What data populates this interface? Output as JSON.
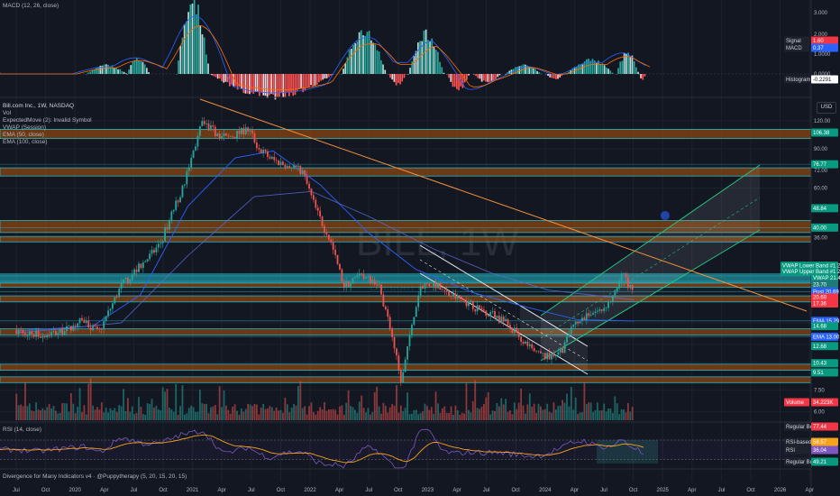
{
  "header": {
    "macd_legend": "MACD (12, 26, close)",
    "symbol_legend": "Bill.com Inc., 1W, NASDAQ",
    "indicator_legend": [
      "Vol",
      "ExpectedMove (2): Invalid Symbol",
      "VWAP (Session)",
      "EMA (50, close)",
      "EMA (100, close)"
    ],
    "rsi_legend": "RSI (14, close)",
    "footer_credit": "Divergence for Many Indicators v4 · @Puppytherapy (5, 20, 15, 20, 15)",
    "currency": "USD",
    "watermark": "BILL, 1W",
    "watermark_sub": "Bill.com Inc."
  },
  "macd_axis": [
    "3.000",
    "2.000",
    "1.0000",
    "0.0000"
  ],
  "macd_tags": [
    {
      "label": "Signal",
      "value": "1.60",
      "color": "#f23645"
    },
    {
      "label": "MACD",
      "value": "0.37",
      "color": "#2962ff"
    },
    {
      "label": "Histogram",
      "value": "-0.2291",
      "color": "#131722"
    }
  ],
  "price_axis": [
    "120.00",
    "90.00",
    "72.00",
    "60.00",
    "36.00",
    "21.00",
    "15.00",
    "12.00",
    "10.00",
    "7.50",
    "6.00"
  ],
  "price_tags": [
    {
      "text": "106.38",
      "bg": "#089981",
      "p": 106.38
    },
    {
      "text": "76.77",
      "bg": "#089981",
      "p": 76.77
    },
    {
      "text": "48.84",
      "bg": "#089981",
      "p": 48.84
    },
    {
      "text": "40.00",
      "bg": "#089981",
      "p": 40.0
    },
    {
      "text": "VWAP Lower Band #1  21.46",
      "bg": "#089981",
      "p": 27.0
    },
    {
      "text": "VWAP Upper Band #1  21.40",
      "bg": "#089981",
      "p": 25.4
    },
    {
      "text": "VWAP  21.40",
      "bg": "#089981",
      "p": 23.8
    },
    {
      "text": "23.70",
      "bg": "#1f7a77",
      "p": 22.3
    },
    {
      "text": "Post  20.69",
      "bg": "#2962ff",
      "p": 20.69
    },
    {
      "text": "20.69",
      "bg": "#f23645",
      "p": 19.5
    },
    {
      "text": "17.36",
      "bg": "#f23645",
      "p": 18.3
    },
    {
      "text": "EMA  15.29",
      "bg": "#2962ff",
      "p": 15.29
    },
    {
      "text": "14.68",
      "bg": "#089981",
      "p": 14.5
    },
    {
      "text": "EMA  13.00",
      "bg": "#2962ff",
      "p": 13.0
    },
    {
      "text": "12.68",
      "bg": "#089981",
      "p": 11.8
    },
    {
      "text": "10.43",
      "bg": "#089981",
      "p": 9.9
    },
    {
      "text": "9.51",
      "bg": "#089981",
      "p": 9.0
    }
  ],
  "vol_tag": {
    "label": "Volume",
    "value": "34.223K"
  },
  "rsi_tags": [
    {
      "label": "Regular Bearish",
      "value": "77.44",
      "color": "#f23645"
    },
    {
      "label": "RSI-based MA",
      "value": "58.57",
      "color": "#f7a21b"
    },
    {
      "label": "RSI",
      "value": "36.04",
      "color": "#7e57c2"
    },
    {
      "label": "Regular Bullish",
      "value": "49.21",
      "color": "#089981"
    }
  ],
  "time_axis": [
    "Jul",
    "Oct",
    "2020",
    "Apr",
    "Jul",
    "Oct",
    "2021",
    "Apr",
    "Jul",
    "Oct",
    "2022",
    "Apr",
    "Jul",
    "Oct",
    "2023",
    "Apr",
    "Jul",
    "Oct",
    "2024",
    "Apr",
    "Jul",
    "Oct",
    "2025",
    "Apr",
    "Jul",
    "Oct",
    "2026",
    "Apr"
  ],
  "colors": {
    "background": "#131722",
    "up": "#26a69a",
    "down": "#ef5350",
    "zone": "#8b4513",
    "teal": "#22b8c7",
    "green": "#4caf50",
    "rsi": "#7e57c2",
    "rsi_ma": "#f7a21b"
  },
  "chart_data": {
    "type": "candlestick",
    "title": "Bill.com Inc., 1W, NASDAQ",
    "scale": "log",
    "ylim": [
      5.5,
      150
    ],
    "prices": [
      {
        "date": "2019-07-01",
        "price": 14.0
      },
      {
        "date": "2019-09-15",
        "price": 13.2
      },
      {
        "date": "2019-12-01",
        "price": 13.8
      },
      {
        "date": "2020-02-01",
        "price": 15.5
      },
      {
        "date": "2020-03-20",
        "price": 13.5
      },
      {
        "date": "2020-06-01",
        "price": 22.0
      },
      {
        "date": "2020-08-01",
        "price": 27.0
      },
      {
        "date": "2020-10-01",
        "price": 33.0
      },
      {
        "date": "2020-11-15",
        "price": 48.0
      },
      {
        "date": "2020-12-15",
        "price": 60.0
      },
      {
        "date": "2021-01-15",
        "price": 85.0
      },
      {
        "date": "2021-02-15",
        "price": 118.0
      },
      {
        "date": "2021-03-15",
        "price": 110.0
      },
      {
        "date": "2021-05-01",
        "price": 100.0
      },
      {
        "date": "2021-07-15",
        "price": 110.0
      },
      {
        "date": "2021-08-15",
        "price": 90.0
      },
      {
        "date": "2021-10-01",
        "price": 80.0
      },
      {
        "date": "2021-11-15",
        "price": 76.0
      },
      {
        "date": "2022-01-01",
        "price": 72.0
      },
      {
        "date": "2022-02-15",
        "price": 48.0
      },
      {
        "date": "2022-04-01",
        "price": 35.0
      },
      {
        "date": "2022-05-15",
        "price": 22.0
      },
      {
        "date": "2022-07-01",
        "price": 24.0
      },
      {
        "date": "2022-09-01",
        "price": 23.0
      },
      {
        "date": "2022-10-15",
        "price": 13.5
      },
      {
        "date": "2022-11-15",
        "price": 8.0
      },
      {
        "date": "2022-12-15",
        "price": 13.5
      },
      {
        "date": "2023-01-15",
        "price": 22.0
      },
      {
        "date": "2023-03-01",
        "price": 22.5
      },
      {
        "date": "2023-04-15",
        "price": 20.0
      },
      {
        "date": "2023-06-01",
        "price": 19.0
      },
      {
        "date": "2023-07-15",
        "price": 17.5
      },
      {
        "date": "2023-09-01",
        "price": 16.5
      },
      {
        "date": "2023-10-15",
        "price": 15.0
      },
      {
        "date": "2023-12-01",
        "price": 13.0
      },
      {
        "date": "2024-01-15",
        "price": 11.0
      },
      {
        "date": "2024-03-01",
        "price": 10.5
      },
      {
        "date": "2024-04-15",
        "price": 11.5
      },
      {
        "date": "2024-05-15",
        "price": 14.0
      },
      {
        "date": "2024-07-01",
        "price": 16.5
      },
      {
        "date": "2024-08-15",
        "price": 17.0
      },
      {
        "date": "2024-10-01",
        "price": 20.0
      },
      {
        "date": "2024-10-25",
        "price": 26.0
      },
      {
        "date": "2024-11-10",
        "price": 22.0
      },
      {
        "date": "2024-12-01",
        "price": 20.69
      }
    ],
    "ema50": [
      {
        "date": "2019-07-01",
        "price": 13.8
      },
      {
        "date": "2020-03-01",
        "price": 14.5
      },
      {
        "date": "2020-08-01",
        "price": 20.0
      },
      {
        "date": "2021-01-01",
        "price": 50.0
      },
      {
        "date": "2021-06-01",
        "price": 82.0
      },
      {
        "date": "2021-10-01",
        "price": 88.0
      },
      {
        "date": "2022-03-01",
        "price": 62.0
      },
      {
        "date": "2022-08-01",
        "price": 38.0
      },
      {
        "date": "2023-01-01",
        "price": 26.0
      },
      {
        "date": "2023-07-01",
        "price": 20.5
      },
      {
        "date": "2024-01-01",
        "price": 17.5
      },
      {
        "date": "2024-06-01",
        "price": 15.5
      },
      {
        "date": "2024-12-01",
        "price": 15.29
      }
    ],
    "ema100": [
      {
        "date": "2019-07-01",
        "price": 13.5
      },
      {
        "date": "2020-06-01",
        "price": 15.0
      },
      {
        "date": "2021-01-01",
        "price": 30.0
      },
      {
        "date": "2021-08-01",
        "price": 55.0
      },
      {
        "date": "2022-02-01",
        "price": 58.0
      },
      {
        "date": "2022-08-01",
        "price": 45.0
      },
      {
        "date": "2023-03-01",
        "price": 32.0
      },
      {
        "date": "2023-09-01",
        "price": 25.0
      },
      {
        "date": "2024-03-01",
        "price": 21.0
      },
      {
        "date": "2024-12-01",
        "price": 19.0
      }
    ],
    "zones": [
      [
        100,
        110
      ],
      [
        68,
        74
      ],
      [
        38,
        43
      ],
      [
        34.5,
        36.5
      ],
      [
        21.6,
        22.6
      ],
      [
        18.6,
        19.8
      ],
      [
        13.2,
        14.1
      ],
      [
        9.2,
        9.8
      ],
      [
        8.1,
        8.6
      ]
    ],
    "lines": [
      13.0,
      15.3,
      20.69,
      23.0,
      24.3,
      40.0,
      76.77
    ],
    "annotations": [
      "descending channel",
      "ascending channel",
      "descending trendline"
    ]
  }
}
